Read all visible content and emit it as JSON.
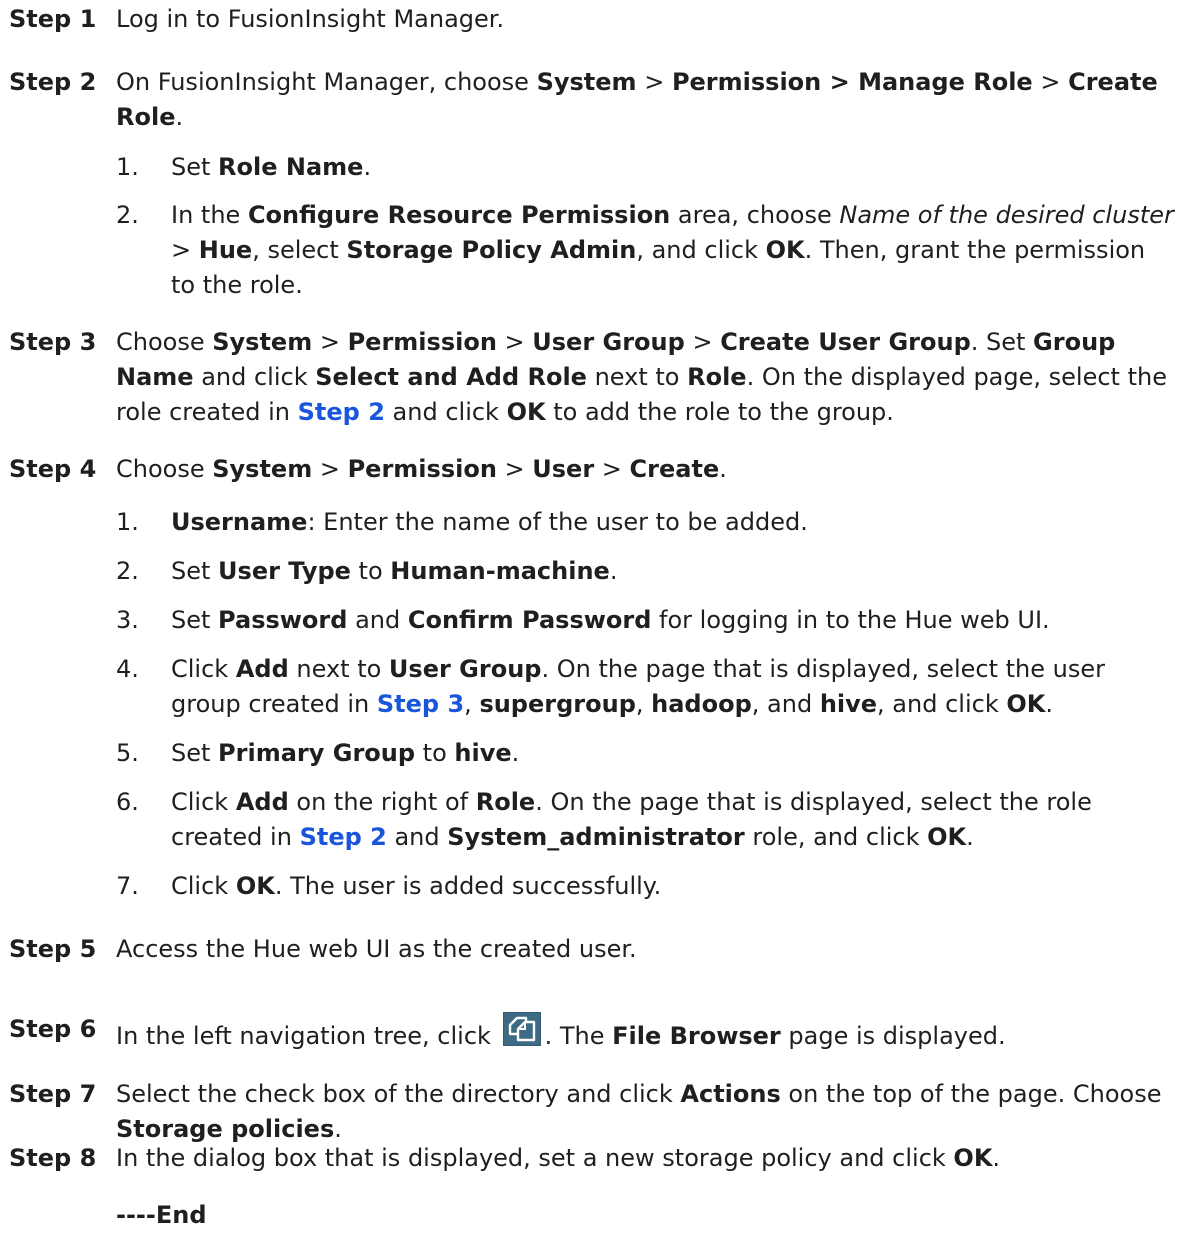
{
  "s1": {
    "label": "Step 1",
    "text": "Log in to FusionInsight Manager."
  },
  "s2": {
    "label": "Step 2",
    "t1": "On FusionInsight Manager, choose ",
    "b1": "System",
    "t2": " > ",
    "b2": "Permission > Manage Role",
    "t3": " > ",
    "b3": "Create Role",
    "t4": "."
  },
  "s2_1": {
    "num": "1.",
    "t1": "Set ",
    "b1": "Role Name",
    "t2": "."
  },
  "s2_2": {
    "num": "2.",
    "t1": "In the ",
    "b1": "Configure Resource Permission",
    "t2": " area, choose ",
    "i1": "Name of the desired cluster",
    "t3": " > ",
    "b2": "Hue",
    "t4": ", select ",
    "b3": "Storage Policy Admin",
    "t5": ", and click ",
    "b4": "OK",
    "t6": ". Then, grant the permission to the role."
  },
  "s3": {
    "label": "Step 3",
    "t1": "Choose ",
    "b1": "System",
    "t2": " > ",
    "b2": "Permission",
    "t3": " > ",
    "b3": "User Group",
    "t4": " > ",
    "b4": "Create User Group",
    "t5": ". Set ",
    "b5": "Group Name",
    "t6": " and click ",
    "b6": "Select and Add Role",
    "t7": " next to ",
    "b7": "Role",
    "t8": ". On the displayed page, select the role created in ",
    "link": "Step 2",
    "t9": " and click ",
    "b8": "OK",
    "t10": " to add the role to the group."
  },
  "s4": {
    "label": "Step 4",
    "t1": "Choose ",
    "b1": "System",
    "t2": " > ",
    "b2": "Permission",
    "t3": " > ",
    "b3": "User",
    "t4": " > ",
    "b4": "Create",
    "t5": "."
  },
  "s4_1": {
    "num": "1.",
    "b1": "Username",
    "t1": ": Enter the name of the user to be added."
  },
  "s4_2": {
    "num": "2.",
    "t1": "Set ",
    "b1": "User Type",
    "t2": " to ",
    "b2": "Human-machine",
    "t3": "."
  },
  "s4_3": {
    "num": "3.",
    "t1": "Set ",
    "b1": "Password",
    "t2": " and ",
    "b2": "Confirm Password",
    "t3": " for logging in to the Hue web UI."
  },
  "s4_4": {
    "num": "4.",
    "t1": "Click ",
    "b1": "Add",
    "t2": " next to ",
    "b2": "User Group",
    "t3": ". On the page that is displayed, select the user group created in ",
    "link": "Step 3",
    "t4": ", ",
    "b3": "supergroup",
    "t5": ", ",
    "b4": "hadoop",
    "t6": ", and ",
    "b5": "hive",
    "t7": ", and click ",
    "b6": "OK",
    "t8": "."
  },
  "s4_5": {
    "num": "5.",
    "t1": "Set ",
    "b1": "Primary Group",
    "t2": " to ",
    "b2": "hive",
    "t3": "."
  },
  "s4_6": {
    "num": "6.",
    "t1": "Click ",
    "b1": "Add",
    "t2": " on the right of ",
    "b2": "Role",
    "t3": ". On the page that is displayed, select the role created in ",
    "link": "Step 2",
    "t4": " and ",
    "b3": "System_administrator",
    "t5": " role, and click ",
    "b4": "OK",
    "t6": "."
  },
  "s4_7": {
    "num": "7.",
    "t1": "Click ",
    "b1": "OK",
    "t2": ". The user is added successfully."
  },
  "s5": {
    "label": "Step 5",
    "text": "Access the Hue web UI as the created user."
  },
  "s6": {
    "label": "Step 6",
    "t1": "In the left navigation tree, click ",
    "icon": "file-browser-icon",
    "t2": ". The ",
    "b1": "File Browser",
    "t3": " page is displayed."
  },
  "s7": {
    "label": "Step 7",
    "t1": "Select the check box of the directory and click ",
    "b1": "Actions",
    "t2": " on the top of the page. Choose ",
    "b2": "Storage policies",
    "t3": "."
  },
  "s8": {
    "label": "Step 8",
    "t1": "In the dialog box that is displayed, set a new storage policy and click ",
    "b1": "OK",
    "t2": "."
  },
  "end": "----End",
  "colors": {
    "text": "#1f1f1f",
    "link": "#1a56db",
    "icon_bg": "#3d6a85",
    "icon_fg": "#ffffff"
  }
}
